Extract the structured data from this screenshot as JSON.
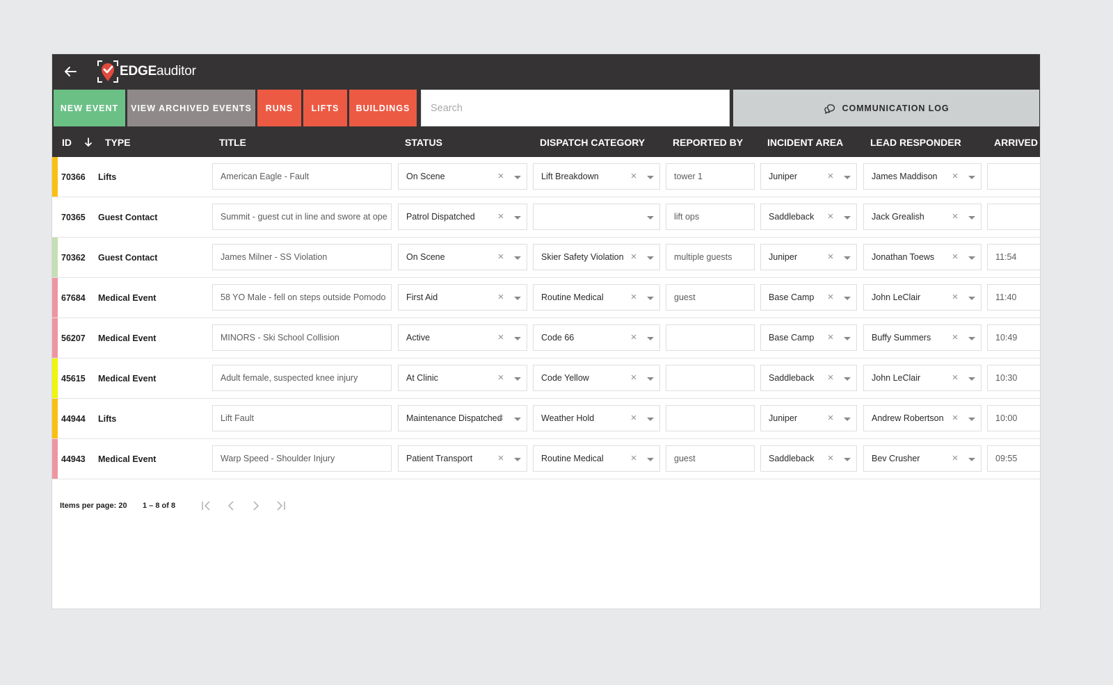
{
  "header": {
    "back_icon": "arrow-left-icon",
    "brand_bold": "EDGE",
    "brand_light": "auditor"
  },
  "toolbar": {
    "new_event": "NEW EVENT",
    "view_archived": "VIEW ARCHIVED EVENTS",
    "runs": "RUNS",
    "lifts": "LIFTS",
    "buildings": "BUILDINGS",
    "search_placeholder": "Search",
    "search_value": "",
    "communication_log": "COMMUNICATION LOG",
    "colors": {
      "green": "#6bc086",
      "grey": "#8f8a89",
      "red": "#ec5a44",
      "commlog": "#cdd0d1"
    }
  },
  "table": {
    "columns": [
      "ID",
      "TYPE",
      "TITLE",
      "STATUS",
      "DISPATCH CATEGORY",
      "REPORTED BY",
      "INCIDENT AREA",
      "LEAD RESPONDER",
      "ARRIVED"
    ],
    "sort": {
      "column": "ID",
      "direction": "descending",
      "icon": "arrow-down-icon"
    },
    "rows": [
      {
        "stripe": "#fbbf10",
        "id": "70366",
        "type": "Lifts",
        "title": "American Eagle - Fault",
        "status": "On Scene",
        "dispatch": "Lift Breakdown",
        "reported_by": "tower 1",
        "area": "Juniper",
        "lead": "James Maddison",
        "arrived": ""
      },
      {
        "stripe": "",
        "id": "70365",
        "type": "Guest Contact",
        "title": "Summit - guest cut in line and swore at ope",
        "status": "Patrol Dispatched",
        "dispatch": "",
        "reported_by": "lift ops",
        "area": "Saddleback",
        "lead": "Jack Grealish",
        "arrived": ""
      },
      {
        "stripe": "#c5dfb4",
        "id": "70362",
        "type": "Guest Contact",
        "title": "James Milner - SS Violation",
        "status": "On Scene",
        "dispatch": "Skier Safety Violation",
        "reported_by": "multiple guests",
        "area": "Juniper",
        "lead": "Jonathan Toews",
        "arrived": "11:54"
      },
      {
        "stripe": "#ef95a1",
        "id": "67684",
        "type": "Medical Event",
        "title": "58 YO Male - fell on steps outside Pomodo",
        "status": "First Aid",
        "dispatch": "Routine Medical",
        "reported_by": "guest",
        "area": "Base Camp",
        "lead": "John LeClair",
        "arrived": "11:40"
      },
      {
        "stripe": "#ef95a1",
        "id": "56207",
        "type": "Medical Event",
        "title": "MINORS - Ski School Collision",
        "status": "Active",
        "dispatch": "Code 66",
        "reported_by": "",
        "area": "Base Camp",
        "lead": "Buffy Summers",
        "arrived": "10:49"
      },
      {
        "stripe": "#eef60a",
        "id": "45615",
        "type": "Medical Event",
        "title": "Adult female, suspected knee injury",
        "status": "At Clinic",
        "dispatch": "Code Yellow",
        "reported_by": "",
        "area": "Saddleback",
        "lead": "John LeClair",
        "arrived": "10:30"
      },
      {
        "stripe": "#fbbf10",
        "id": "44944",
        "type": "Lifts",
        "title": "Lift Fault",
        "status": "Maintenance Dispatched",
        "dispatch": "Weather Hold",
        "reported_by": "",
        "area": "Juniper",
        "lead": "Andrew Robertson",
        "arrived": "10:00"
      },
      {
        "stripe": "#ef95a1",
        "id": "44943",
        "type": "Medical Event",
        "title": "Warp Speed - Shoulder Injury",
        "status": "Patient Transport",
        "dispatch": "Routine Medical",
        "reported_by": "guest",
        "area": "Saddleback",
        "lead": "Bev Crusher",
        "arrived": "09:55"
      }
    ]
  },
  "paginator": {
    "items_per_page_label": "Items per page: 20",
    "range_label": "1 – 8 of 8",
    "icons": [
      "first-page-icon",
      "prev-page-icon",
      "next-page-icon",
      "last-page-icon"
    ]
  }
}
